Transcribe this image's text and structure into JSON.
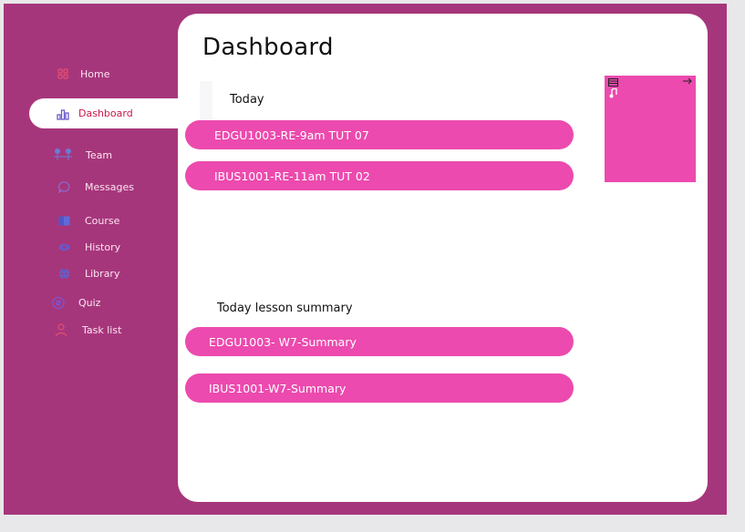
{
  "sidebar": {
    "items": [
      {
        "label": "Home",
        "icon": "grid-icon",
        "active": false
      },
      {
        "label": "Dashboard",
        "icon": "bar-chart-icon",
        "active": true
      },
      {
        "label": "Team",
        "icon": "team-icon",
        "active": false
      },
      {
        "label": "Messages",
        "icon": "chat-bubble-icon",
        "active": false
      },
      {
        "label": "Course",
        "icon": "book-icon",
        "active": false
      },
      {
        "label": "History",
        "icon": "eye-icon",
        "active": false
      },
      {
        "label": "Library",
        "icon": "globe-icon",
        "active": false
      },
      {
        "label": "Quiz",
        "icon": "target-icon",
        "active": false
      },
      {
        "label": "Task list",
        "icon": "user-icon",
        "active": false
      }
    ]
  },
  "main": {
    "title": "Dashboard",
    "today": {
      "label": "Today",
      "items": [
        "EDGU1003-RE-9am TUT 07",
        "IBUS1001-RE-11am TUT 02"
      ]
    },
    "summary": {
      "label": "Today lesson summary",
      "items": [
        "EDGU1003- W7-Summary",
        "IBUS1001-W7-Summary"
      ]
    }
  },
  "widget": {
    "icons": [
      "window-icon",
      "arrow-right-icon",
      "music-note-icon"
    ]
  },
  "colors": {
    "frame": "#a6367b",
    "accent_pink": "#ec4aae",
    "active_text": "#c9184a",
    "panel": "#ffffff"
  }
}
